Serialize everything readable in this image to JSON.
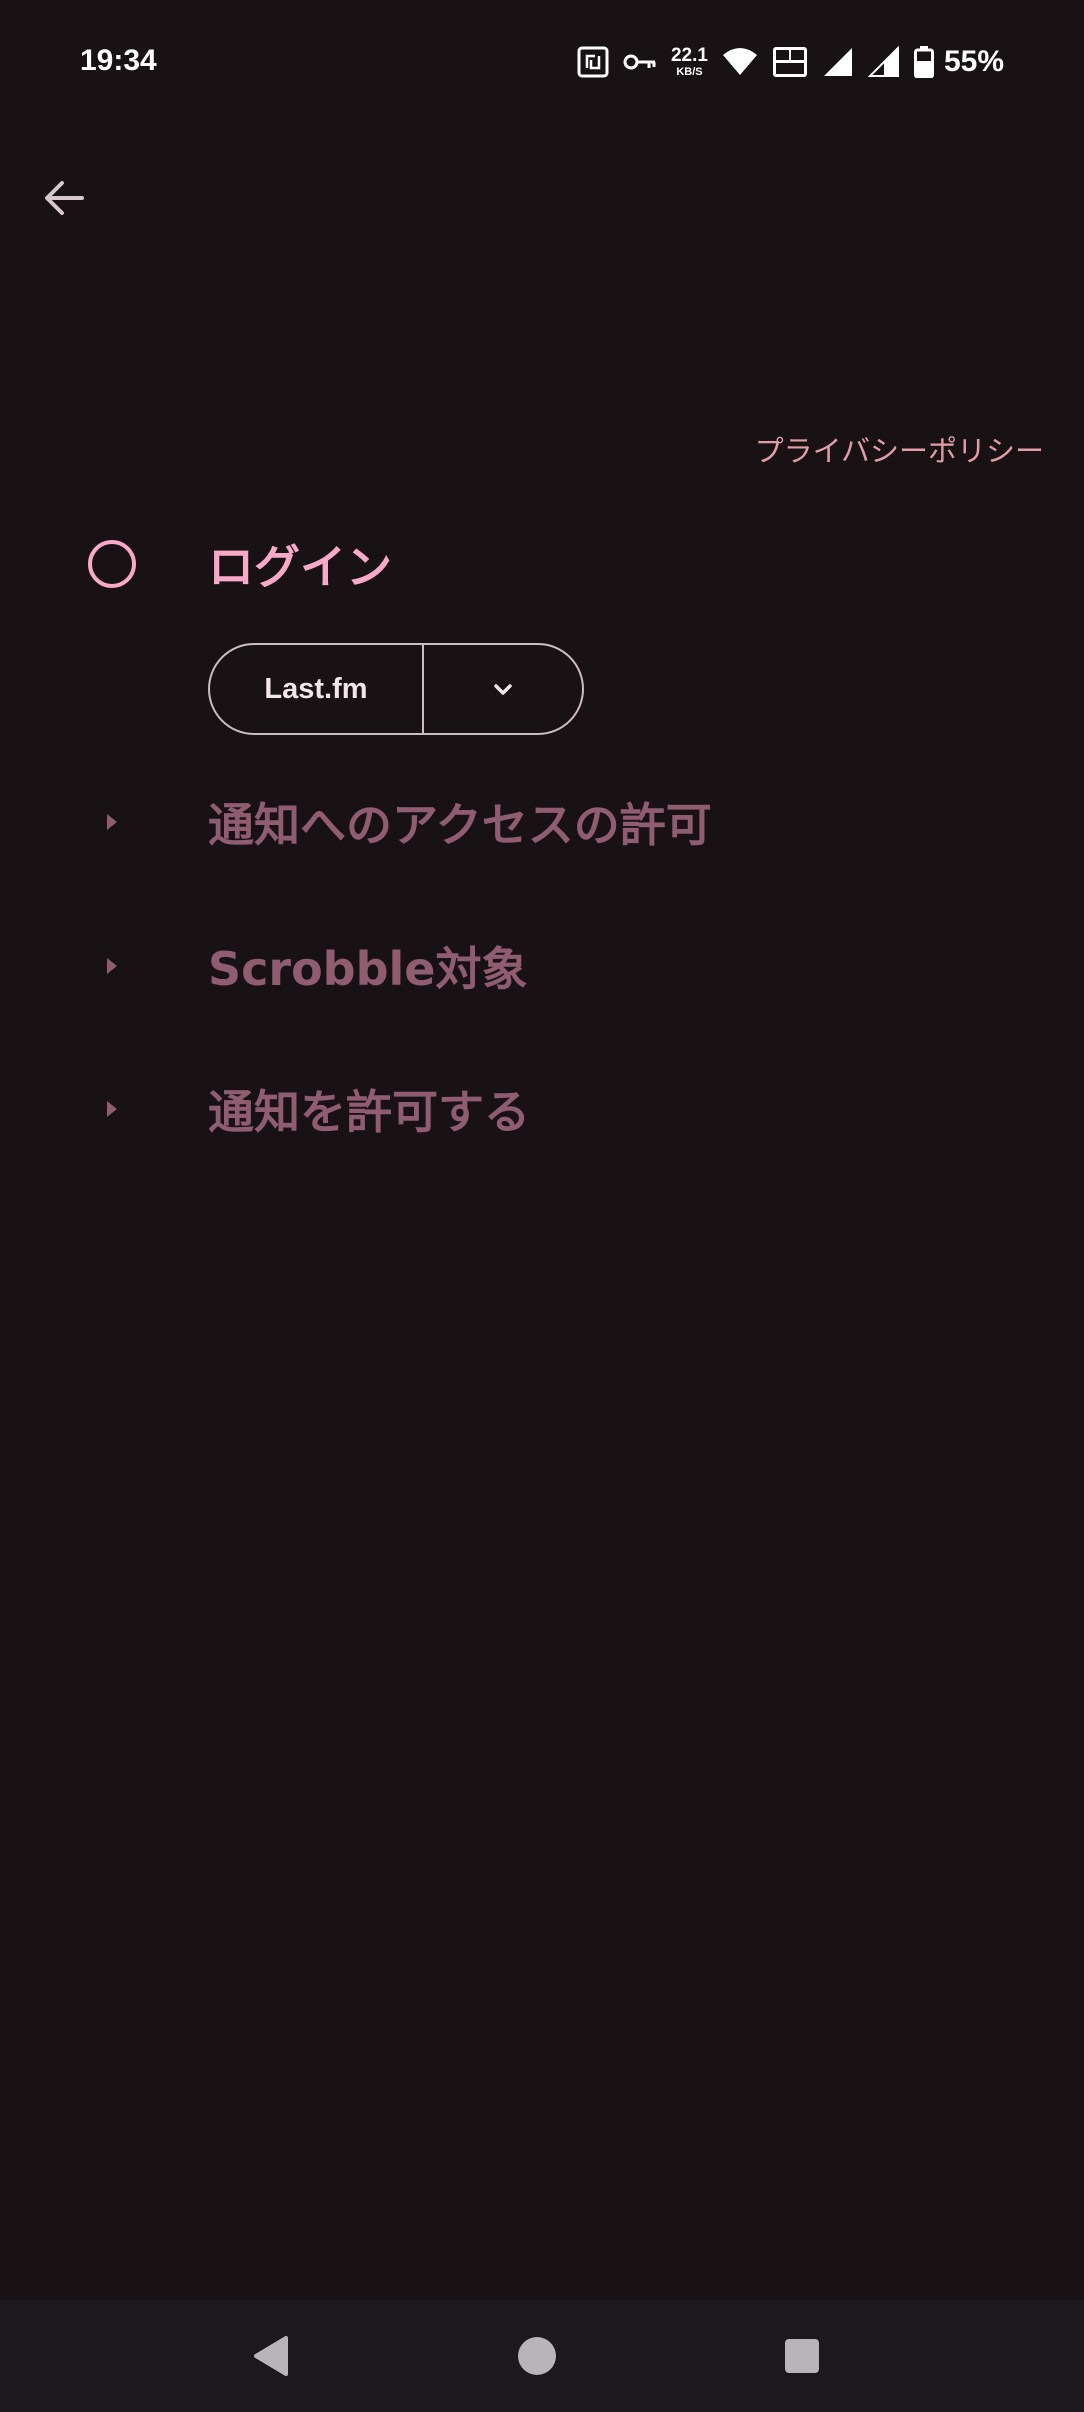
{
  "status_bar": {
    "time": "19:34",
    "net_speed_value": "22.1",
    "net_speed_unit": "KB/S",
    "battery": "55%",
    "icons": [
      "nfc-icon",
      "vpn-key-icon",
      "wifi-icon",
      "volte-icon",
      "signal-icon",
      "signal-icon",
      "battery-icon"
    ]
  },
  "header": {
    "back_icon": "arrow-left-icon",
    "privacy_link": "プライバシーポリシー"
  },
  "steps": [
    {
      "title": "ログイン",
      "state": "active",
      "indicator": "circle-outline-icon"
    },
    {
      "title": "通知へのアクセスの許可",
      "state": "collapsed",
      "indicator": "triangle-right-icon"
    },
    {
      "title": "Scrobble対象",
      "state": "collapsed",
      "indicator": "triangle-right-icon"
    },
    {
      "title": "通知を許可する",
      "state": "collapsed",
      "indicator": "triangle-right-icon"
    }
  ],
  "login_button": {
    "label": "Last.fm",
    "dropdown_icon": "chevron-down-icon"
  },
  "colors": {
    "background": "#181215",
    "accent": "#f7a9c7",
    "muted": "#8f5d6f",
    "link": "#e39da6"
  },
  "nav_bar": {
    "buttons": [
      "back-triangle-icon",
      "home-circle-icon",
      "recents-square-icon"
    ]
  }
}
